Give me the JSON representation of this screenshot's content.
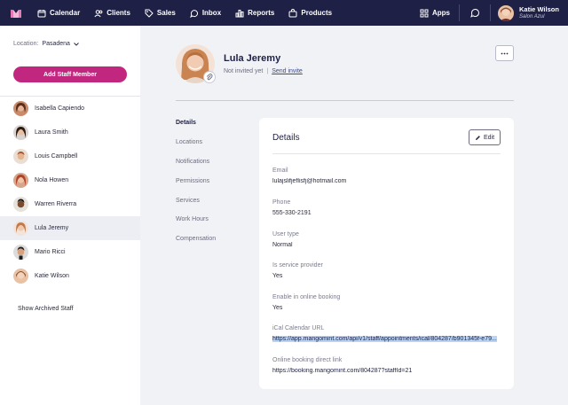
{
  "nav": {
    "items": [
      {
        "label": "Calendar",
        "icon": "calendar-icon"
      },
      {
        "label": "Clients",
        "icon": "clients-icon"
      },
      {
        "label": "Sales",
        "icon": "tag-icon"
      },
      {
        "label": "Inbox",
        "icon": "inbox-icon"
      },
      {
        "label": "Reports",
        "icon": "bar-chart-icon"
      },
      {
        "label": "Products",
        "icon": "bag-icon"
      }
    ],
    "apps_label": "Apps",
    "user_name": "Katie Wilson",
    "user_business": "Salon Azul"
  },
  "sidebar": {
    "location_label": "Location:",
    "location_value": "Pasadena",
    "add_button": "Add Staff Member",
    "staff": [
      "Isabella Capiendo",
      "Laura Smith",
      "Louis Campbell",
      "Nola Howen",
      "Warren Riverra",
      "Lula Jeremy",
      "Mario Ricci",
      "Katie Wilson"
    ],
    "active_index": 5,
    "archived_link": "Show Archived Staff"
  },
  "profile": {
    "name": "Lula Jeremy",
    "status": "Not invited yet",
    "separator": "|",
    "invite_link": "Send invite"
  },
  "subnav": [
    "Details",
    "Locations",
    "Notifications",
    "Permissions",
    "Services",
    "Work Hours",
    "Compensation"
  ],
  "details": {
    "title": "Details",
    "edit_label": "Edit",
    "email_label": "Email",
    "email": "lulajslifjeflisfj@hotmail.com",
    "phone_label": "Phone",
    "phone": "555-330-2191",
    "user_type_label": "User type",
    "user_type": "Normal",
    "service_provider_label": "Is service provider",
    "service_provider": "Yes",
    "online_booking_label": "Enable in online booking",
    "online_booking": "Yes",
    "ical_label": "iCal Calendar URL",
    "ical_url": "https://app.mangomint.com/api/v1/staff/appointments/ical/804287/b901345f-e79...",
    "booking_link_label": "Online booking direct link",
    "booking_link": "https://booking.mangomint.com/804287?staffId=21"
  },
  "colors": {
    "nav_bg": "#1e2046",
    "accent": "#c2277f",
    "page_bg": "#f1f2f6",
    "selection": "#b9d4f6"
  }
}
